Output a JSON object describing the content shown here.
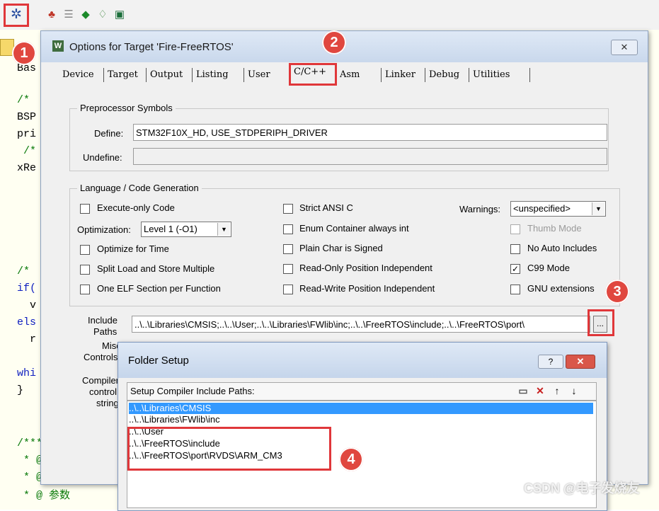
{
  "toolbar": {
    "icons": [
      "magic-wand-icon",
      "load-icon",
      "stack-icon",
      "diamond-icon",
      "download-icon",
      "chip-icon"
    ]
  },
  "editor": {
    "lines": [
      {
        "text": "Bas",
        "style": "plain"
      },
      {
        "text": "/*",
        "style": "cm"
      },
      {
        "text": "BSP",
        "style": "plain"
      },
      {
        "text": "pri",
        "style": "plain"
      },
      {
        "text": " /*",
        "style": "cm"
      },
      {
        "text": "xRe",
        "style": "plain"
      },
      {
        "text": "/*",
        "style": "cm"
      },
      {
        "text": "if(",
        "style": "kw"
      },
      {
        "text": "  v",
        "style": "plain"
      },
      {
        "text": "els",
        "style": "kw"
      },
      {
        "text": "  r",
        "style": "plain"
      },
      {
        "text": "whi",
        "style": "kw"
      },
      {
        "text": "}",
        "style": "plain"
      },
      {
        "text": "/****",
        "style": "cm"
      },
      {
        "text": " * @",
        "style": "cm"
      },
      {
        "text": " * @",
        "style": "cm"
      },
      {
        "text": " * @ 参数",
        "style": "cm"
      }
    ]
  },
  "options_dialog": {
    "title": "Options for Target 'Fire-FreeRTOS'",
    "title_icon": "W",
    "close_label": "✕",
    "tabs": [
      "Device",
      "Target",
      "Output",
      "Listing",
      "User",
      "C/C++",
      "Asm",
      "Linker",
      "Debug",
      "Utilities"
    ],
    "active_tab": "C/C++",
    "preprocessor": {
      "group_title": "Preprocessor Symbols",
      "define_label": "Define:",
      "define_value": "STM32F10X_HD, USE_STDPERIPH_DRIVER",
      "undefine_label": "Undefine:",
      "undefine_value": ""
    },
    "codegen": {
      "group_title": "Language / Code Generation",
      "execute_only": "Execute-only Code",
      "optimization_label": "Optimization:",
      "optimization_value": "Level 1 (-O1)",
      "optimize_time": "Optimize for Time",
      "split_load": "Split Load and Store Multiple",
      "one_elf": "One ELF Section per Function",
      "strict_ansi": "Strict ANSI C",
      "enum_container": "Enum Container always int",
      "plain_char": "Plain Char is Signed",
      "ro_pi": "Read-Only Position Independent",
      "rw_pi": "Read-Write Position Independent",
      "warnings_label": "Warnings:",
      "warnings_value": "<unspecified>",
      "thumb_mode": "Thumb Mode",
      "no_auto_includes": "No Auto Includes",
      "c99_mode": "C99 Mode",
      "c99_checked": "✓",
      "gnu_extensions": "GNU extensions"
    },
    "include_paths": {
      "label_line1": "Include",
      "label_line2": "Paths",
      "value": "..\\..\\Libraries\\CMSIS;..\\..\\User;..\\..\\Libraries\\FWlib\\inc;..\\..\\FreeRTOS\\include;..\\..\\FreeRTOS\\port\\",
      "browse_label": "..."
    },
    "misc": {
      "label_line1": "Misc",
      "label_line2": "Controls"
    },
    "compiler": {
      "label_line1": "Compiler",
      "label_line2": "control",
      "label_line3": "string"
    }
  },
  "folder_dialog": {
    "title": "Folder Setup",
    "help_label": "?",
    "close_label": "✕",
    "header_label": "Setup Compiler Include Paths:",
    "paths": [
      "..\\..\\Libraries\\CMSIS",
      "..\\..\\Libraries\\FWlib\\inc",
      "..\\..\\User",
      "..\\..\\FreeRTOS\\include",
      "..\\..\\FreeRTOS\\port\\RVDS\\ARM_CM3"
    ],
    "selected_index": 0
  },
  "badges": [
    "1",
    "2",
    "3",
    "4"
  ],
  "watermark": "CSDN @电子发烧友",
  "colors": {
    "accent_red": "#e0373a",
    "badge": "#e0473f",
    "selection": "#3399ff",
    "title_bar": "#c9d8ec"
  }
}
